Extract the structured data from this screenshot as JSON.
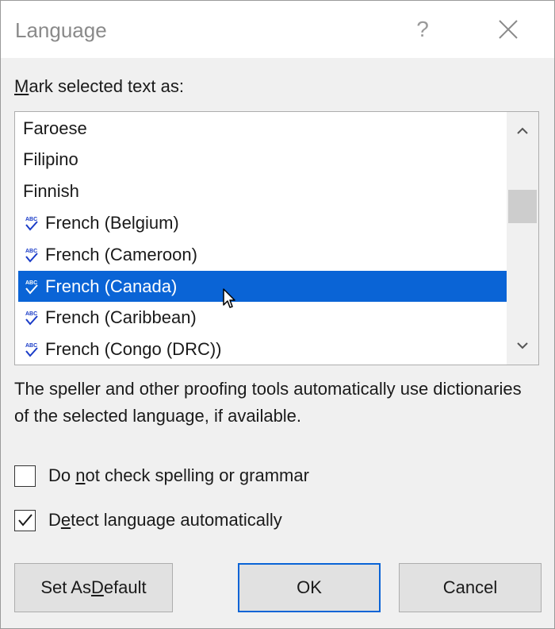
{
  "dialog": {
    "title": "Language",
    "help_glyph": "?",
    "close_icon": "close-icon"
  },
  "section_label": {
    "accel": "M",
    "rest": "ark selected text as:"
  },
  "languages": [
    {
      "label": "Faroese",
      "proofing": false,
      "selected": false
    },
    {
      "label": "Filipino",
      "proofing": false,
      "selected": false
    },
    {
      "label": "Finnish",
      "proofing": false,
      "selected": false
    },
    {
      "label": "French (Belgium)",
      "proofing": true,
      "selected": false
    },
    {
      "label": "French (Cameroon)",
      "proofing": true,
      "selected": false
    },
    {
      "label": "French (Canada)",
      "proofing": true,
      "selected": true
    },
    {
      "label": "French (Caribbean)",
      "proofing": true,
      "selected": false
    },
    {
      "label": "French (Congo (DRC))",
      "proofing": true,
      "selected": false
    }
  ],
  "description": "The speller and other proofing tools automatically use dictionaries of the selected language, if available.",
  "options": {
    "no_check": {
      "pre": "Do ",
      "accel": "n",
      "post": "ot check spelling or grammar",
      "checked": false
    },
    "detect": {
      "pre": "D",
      "accel": "e",
      "post": "tect language automatically",
      "checked": true
    }
  },
  "buttons": {
    "set_default": {
      "pre": "Set As ",
      "accel": "D",
      "post": "efault"
    },
    "ok": "OK",
    "cancel": "Cancel"
  },
  "colors": {
    "selection": "#0a64d6",
    "ok_border": "#0a64d6",
    "proofing_icon": "#1a3cc8"
  }
}
